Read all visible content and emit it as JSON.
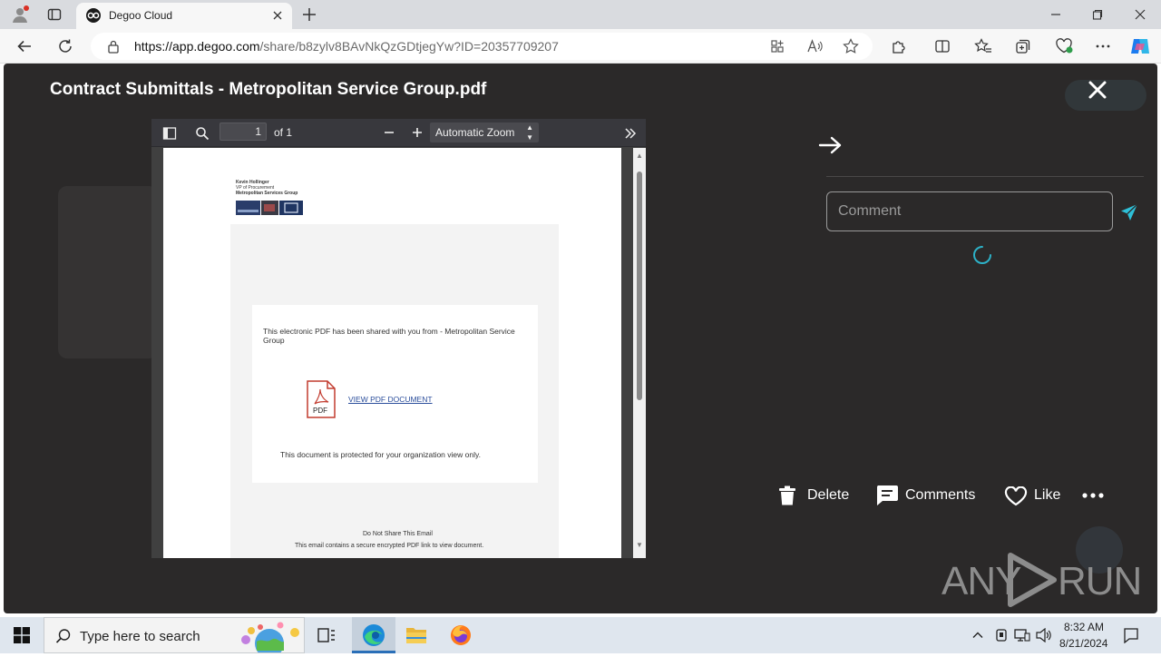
{
  "browser": {
    "tab_title": "Degoo Cloud",
    "url_host": "https://app.degoo.com",
    "url_path": "/share/b8zylv8BAvNkQzGDtjegYw?ID=20357709207"
  },
  "viewer": {
    "title": "Contract Submittals - Metropolitan Service Group.pdf"
  },
  "pdf_toolbar": {
    "page_value": "1",
    "page_of": "of 1",
    "zoom": "Automatic Zoom"
  },
  "pdf_content": {
    "header_line1": "Kevin Hollinger",
    "header_line2": "VP of Procurement",
    "header_line3": "Metropolitan Services Group",
    "shared_text": "This electronic PDF has been shared with you from - Metropolitan Service Group",
    "pdf_icon_label": "PDF",
    "view_link": "VIEW PDF DOCUMENT",
    "protected_text": "This document is protected for your organization view only.",
    "footer1": "Do Not Share This Email",
    "footer2": "This email contains a secure encrypted PDF link to view document."
  },
  "comments_panel": {
    "placeholder": "Comment"
  },
  "actions": {
    "delete": "Delete",
    "comments": "Comments",
    "like": "Like"
  },
  "watermark": {
    "left": "ANY",
    "right": "RUN"
  },
  "taskbar": {
    "search_placeholder": "Type here to search",
    "time": "8:32 AM",
    "date": "8/21/2024"
  }
}
